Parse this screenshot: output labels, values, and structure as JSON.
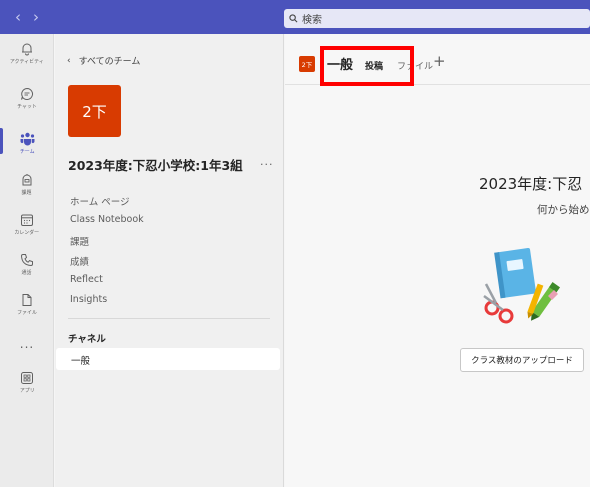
{
  "search": {
    "placeholder": "検索"
  },
  "rail": [
    {
      "label": "アクティビティ",
      "icon": "bell-icon"
    },
    {
      "label": "チャット",
      "icon": "chat-icon"
    },
    {
      "label": "チーム",
      "icon": "teams-icon",
      "active": true
    },
    {
      "label": "課題",
      "icon": "assignments-icon"
    },
    {
      "label": "カレンダー",
      "icon": "calendar-icon"
    },
    {
      "label": "通話",
      "icon": "phone-icon"
    },
    {
      "label": "ファイル",
      "icon": "file-icon"
    },
    {
      "label": "アプリ",
      "icon": "apps-icon"
    }
  ],
  "rail_more": "...",
  "team_pane": {
    "back": "すべてのチーム",
    "avatar_text": "2下",
    "team_name": "2023年度:下忍小学校:1年3組",
    "more": "...",
    "menu": [
      "ホーム ページ",
      "Class Notebook",
      "課題",
      "成績",
      "Reflect",
      "Insights"
    ],
    "channels_header": "チャネル",
    "channels": [
      "一般"
    ]
  },
  "channel": {
    "avatar_text": "2下",
    "title": "一般",
    "tabs": {
      "posts": "投稿",
      "files": "ファイル",
      "add": "+"
    }
  },
  "welcome": {
    "title": "2023年度:下忍",
    "subtitle": "何から始め",
    "upload_button": "クラス教材のアップロード"
  },
  "colors": {
    "brand": "#4b53bc",
    "team_avatar": "#d83b01",
    "highlight": "#ff0000"
  }
}
